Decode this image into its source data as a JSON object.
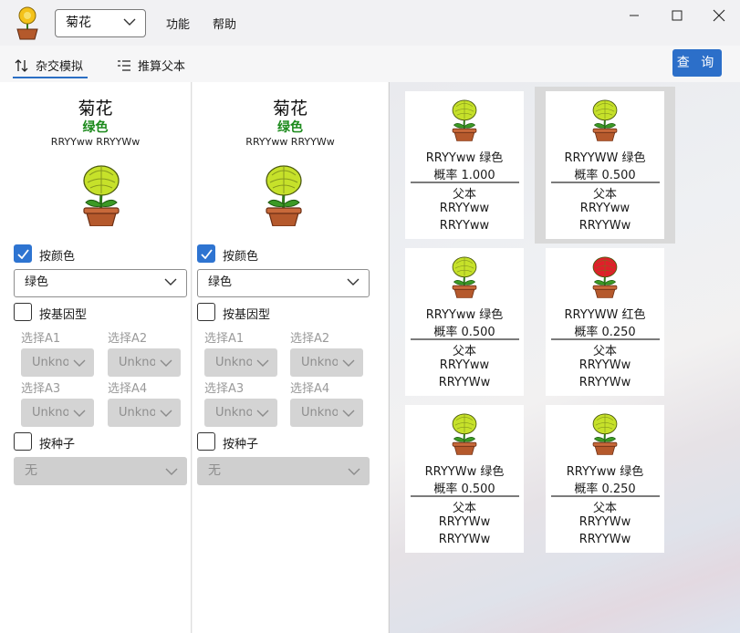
{
  "titlebar": {
    "flower_select": "菊花",
    "menu": [
      "功能",
      "帮助"
    ]
  },
  "toolbar": {
    "tab_cross": "杂交模拟",
    "tab_parent": "推算父本",
    "query": "查 询"
  },
  "panels": [
    {
      "name": "菊花",
      "color": "绿色",
      "genotype": "RRYYww RRYYWw",
      "by_color": "按颜色",
      "color_value": "绿色",
      "by_gene": "按基因型",
      "select_labels": [
        "选择A1",
        "选择A2",
        "选择A3",
        "选择A4"
      ],
      "select_values": [
        "Unknown",
        "Unknown",
        "Unknown",
        "Unknown"
      ],
      "by_seed": "按种子",
      "seed_value": "无"
    },
    {
      "name": "菊花",
      "color": "绿色",
      "genotype": "RRYYww RRYYWw",
      "by_color": "按颜色",
      "color_value": "绿色",
      "by_gene": "按基因型",
      "select_labels": [
        "选择A1",
        "选择A2",
        "选择A3",
        "选择A4"
      ],
      "select_values": [
        "Unknown",
        "Unknown",
        "Unknown",
        "Unknown"
      ],
      "by_seed": "按种子",
      "seed_value": "无"
    }
  ],
  "results": [
    {
      "geno_color": "RRYYww  绿色",
      "prob": "概率  1.000",
      "parent_label": "父本",
      "parent1": "RRYYww",
      "parent2": "RRYYww",
      "flower_color": "#c6e12a"
    },
    {
      "geno_color": "RRYYWW  绿色",
      "prob": "概率  0.500",
      "parent_label": "父本",
      "parent1": "RRYYww",
      "parent2": "RRYYWw",
      "flower_color": "#c6e12a"
    },
    {
      "geno_color": "RRYYww  绿色",
      "prob": "概率  0.500",
      "parent_label": "父本",
      "parent1": "RRYYww",
      "parent2": "RRYYWw",
      "flower_color": "#c6e12a"
    },
    {
      "geno_color": "RRYYWW  红色",
      "prob": "概率  0.250",
      "parent_label": "父本",
      "parent1": "RRYYWw",
      "parent2": "RRYYWw",
      "flower_color": "#e01f2a"
    },
    {
      "geno_color": "RRYYWw  绿色",
      "prob": "概率  0.500",
      "parent_label": "父本",
      "parent1": "RRYYWw",
      "parent2": "RRYYWw",
      "flower_color": "#c6e12a"
    },
    {
      "geno_color": "RRYYww  绿色",
      "prob": "概率  0.250",
      "parent_label": "父本",
      "parent1": "RRYYWw",
      "parent2": "RRYYWw",
      "flower_color": "#c6e12a"
    }
  ]
}
